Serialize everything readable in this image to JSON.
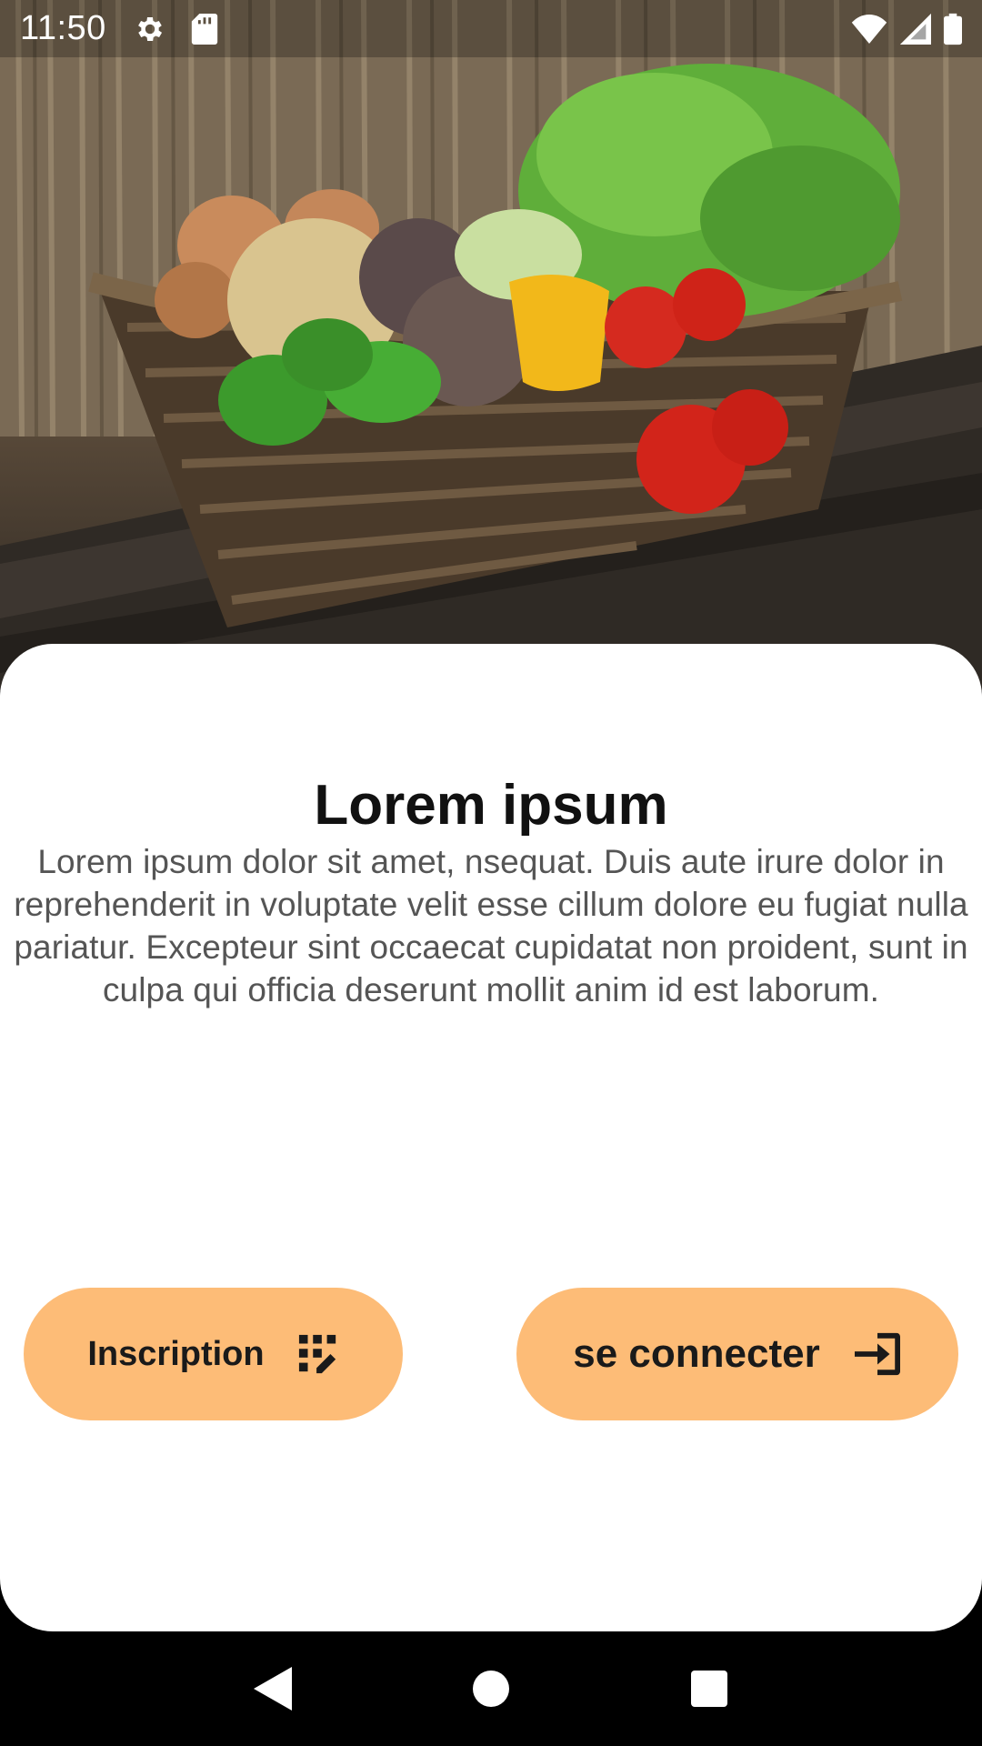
{
  "status_bar": {
    "time": "11:50",
    "left_icons": [
      "settings-icon",
      "sd-card-icon"
    ],
    "right_icons": [
      "wifi-icon",
      "signal-icon",
      "battery-icon"
    ]
  },
  "hero": {
    "image": "vegetable-basket-photo"
  },
  "card": {
    "title": "Lorem ipsum",
    "body_lines": [
      "Lorem ipsum dolor sit amet,  nsequat. Duis aute irure dolor in",
      "reprehenderit in voluptate velit esse cillum dolore eu fugiat nulla",
      "pariatur. Excepteur sint occaecat cupidatat non proident, sunt in",
      "culpa qui officia deserunt mollit anim id est laborum."
    ]
  },
  "buttons": {
    "signup_label": "Inscription",
    "signup_icon": "app-registration-icon",
    "login_label": "se connecter",
    "login_icon": "login-icon"
  },
  "nav_bar": {
    "items": [
      "back-icon",
      "home-icon",
      "recents-icon"
    ]
  },
  "colors": {
    "button_bg": "#fdbc77",
    "card_bg": "#ffffff",
    "title": "#111111",
    "body": "#555555"
  }
}
